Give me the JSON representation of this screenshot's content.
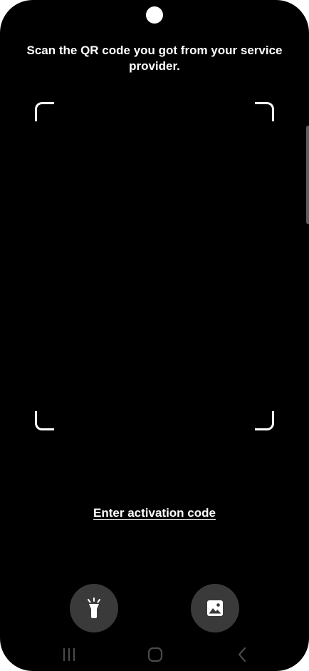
{
  "instruction": "Scan the QR code you got from your service provider.",
  "activation_link": "Enter activation code",
  "buttons": {
    "flashlight_icon": "flashlight-icon",
    "gallery_icon": "image-gallery-icon"
  },
  "navbar": {
    "recents_icon": "recents-icon",
    "home_icon": "home-icon",
    "back_icon": "back-icon"
  },
  "colors": {
    "background": "#000000",
    "text": "#ffffff",
    "button_bg": "#3a3a3a",
    "nav_icon": "#4a4a4a"
  }
}
